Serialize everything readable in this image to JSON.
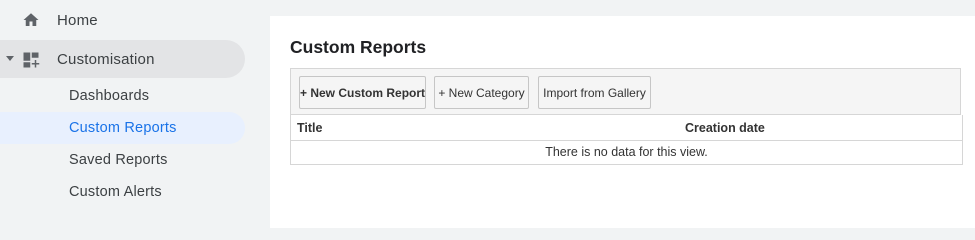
{
  "sidebar": {
    "home": {
      "label": "Home",
      "icon": "home-icon"
    },
    "customisation": {
      "label": "Customisation",
      "icon": "dashboard-icon",
      "expanded": true
    },
    "sub_items": [
      {
        "label": "Dashboards",
        "active": false
      },
      {
        "label": "Custom Reports",
        "active": true
      },
      {
        "label": "Saved Reports",
        "active": false
      },
      {
        "label": "Custom Alerts",
        "active": false
      }
    ]
  },
  "main": {
    "title": "Custom Reports",
    "toolbar": {
      "new_report_label": "+ New Custom Report",
      "new_category_label": "+ New Category",
      "import_label": "Import from Gallery"
    },
    "table": {
      "columns": [
        "Title",
        "Creation date"
      ],
      "empty_message": "There is no data for this view."
    }
  },
  "colors": {
    "accent": "#1a73e8",
    "active_bg": "#e8f0fe",
    "sidebar_bg": "#f1f3f4"
  }
}
